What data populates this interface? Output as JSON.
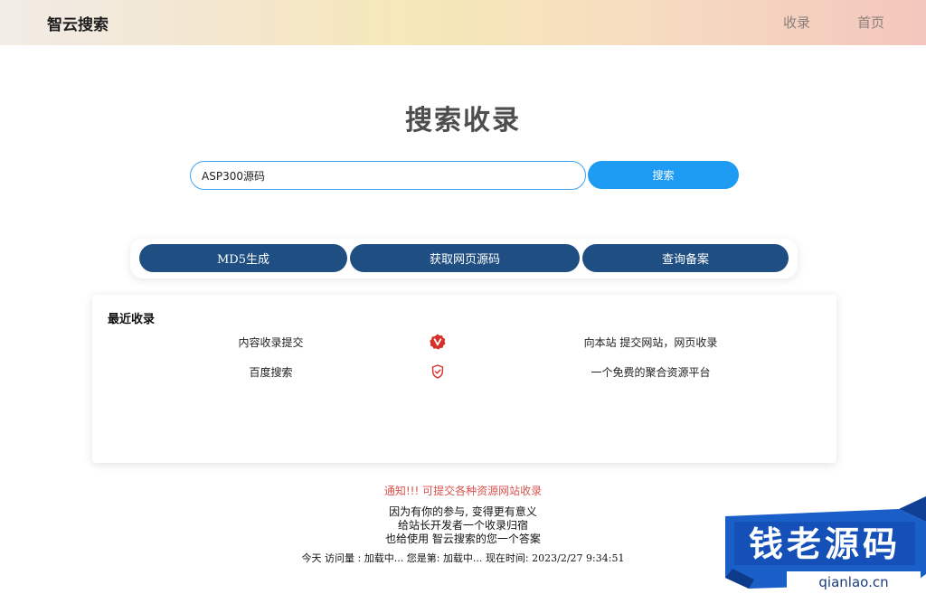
{
  "header": {
    "brand": "智云搜索",
    "nav": [
      {
        "label": "收录"
      },
      {
        "label": "首页"
      }
    ]
  },
  "main": {
    "title": "搜索收录",
    "search": {
      "value": "ASP300源码",
      "button_label": "搜索"
    },
    "tools": [
      {
        "label": "MD5生成"
      },
      {
        "label": "获取网页源码"
      },
      {
        "label": "查询备案"
      }
    ]
  },
  "recent": {
    "title": "最近收录",
    "rows": [
      {
        "name": "内容收录提交",
        "icon": "v-badge-icon",
        "desc": "向本站 提交网站，网页收录"
      },
      {
        "name": "百度搜索",
        "icon": "shield-check-icon",
        "desc": "一个免费的聚合资源平台"
      }
    ]
  },
  "footer": {
    "notice": "通知!!! 可提交各种资源网站收录",
    "lines": [
      "因为有你的参与, 变得更有意义",
      "给站长开发者一个收录归宿",
      "也给使用 智云搜索的您一个答案"
    ],
    "stats": {
      "today_label": "今天 访问量 :",
      "today_value": "加载中...",
      "rank_label": "您是第:",
      "rank_value": "加载中...",
      "time_label": "现在时间:",
      "time_value": "2023/2/27 9:34:51"
    }
  },
  "watermark": {
    "text": "钱老源码",
    "url": "qianlao.cn"
  },
  "colors": {
    "primary_blue": "#1e9bf2",
    "tool_blue": "#1f4f82",
    "notice_red": "#d9534f",
    "icon_red": "#d6302a"
  }
}
